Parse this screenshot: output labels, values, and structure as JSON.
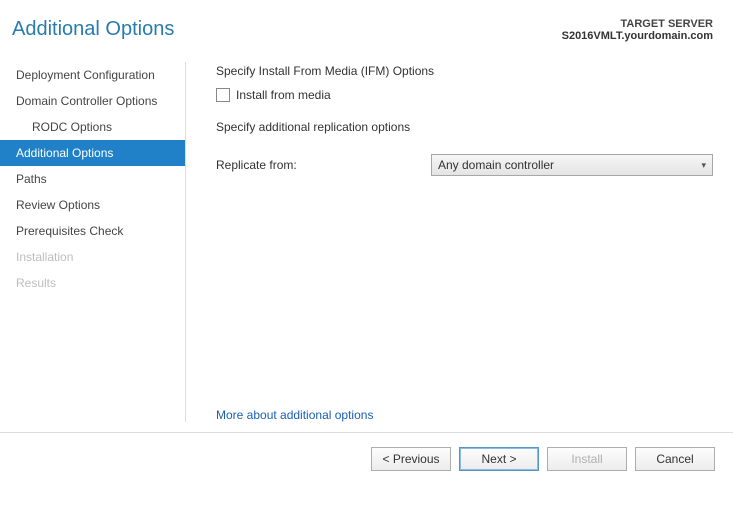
{
  "header": {
    "title": "Additional Options",
    "target_label": "TARGET SERVER",
    "target_server": "S2016VMLT.yourdomain.com"
  },
  "sidebar": {
    "items": [
      {
        "label": "Deployment Configuration",
        "state": "normal"
      },
      {
        "label": "Domain Controller Options",
        "state": "normal"
      },
      {
        "label": "RODC Options",
        "state": "indent"
      },
      {
        "label": "Additional Options",
        "state": "selected"
      },
      {
        "label": "Paths",
        "state": "normal"
      },
      {
        "label": "Review Options",
        "state": "normal"
      },
      {
        "label": "Prerequisites Check",
        "state": "normal"
      },
      {
        "label": "Installation",
        "state": "disabled"
      },
      {
        "label": "Results",
        "state": "disabled"
      }
    ]
  },
  "main": {
    "ifm_label": "Specify Install From Media (IFM) Options",
    "ifm_checkbox_label": "Install from media",
    "ifm_checked": false,
    "replication_heading": "Specify additional replication options",
    "replicate_from_label": "Replicate from:",
    "replicate_from_value": "Any domain controller",
    "more_link": "More about additional options"
  },
  "footer": {
    "previous": "< Previous",
    "next": "Next >",
    "install": "Install",
    "cancel": "Cancel"
  }
}
